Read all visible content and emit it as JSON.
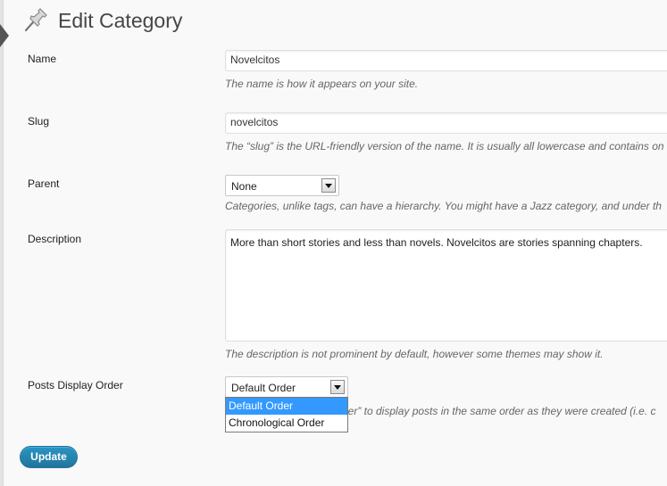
{
  "page": {
    "title": "Edit Category",
    "page_icon": "pushpin-icon"
  },
  "form": {
    "name": {
      "label": "Name",
      "value": "Novelcitos",
      "help": "The name is how it appears on your site."
    },
    "slug": {
      "label": "Slug",
      "value": "novelcitos",
      "help": "The “slug” is the URL-friendly version of the name. It is usually all lowercase and contains on"
    },
    "parent": {
      "label": "Parent",
      "selected": "None",
      "help": "Categories, unlike tags, can have a hierarchy. You might have a Jazz category, and under th"
    },
    "description": {
      "label": "Description",
      "value": "More than short stories and less than novels. Novelcitos are stories spanning chapters.",
      "help": "The description is not prominent by default, however some themes may show it."
    },
    "posts_display_order": {
      "label": "Posts Display Order",
      "selected": "Default Order",
      "options": [
        "Default Order",
        "Chronological Order"
      ],
      "help_visible": "rder” to display posts in the same order as they were created (i.e. c"
    }
  },
  "actions": {
    "update_label": "Update"
  },
  "colors": {
    "primary_button": "#21759b",
    "dropdown_highlight": "#3399ff",
    "help_text": "#666666"
  }
}
